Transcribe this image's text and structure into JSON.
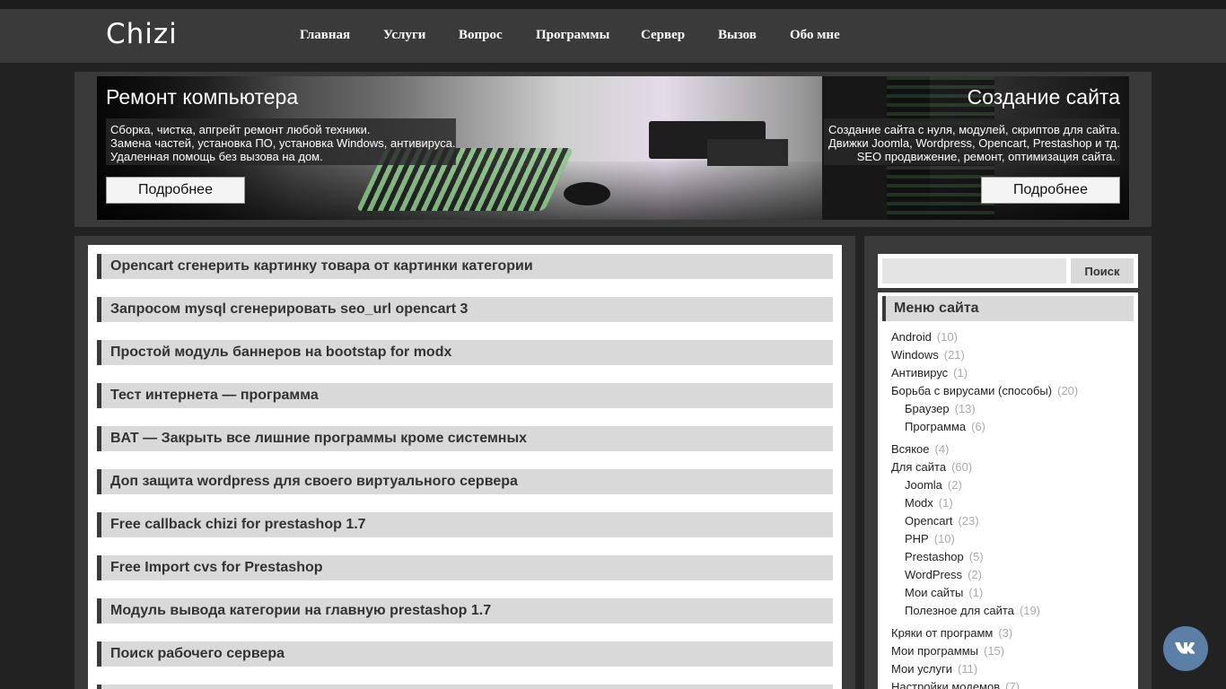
{
  "header": {
    "logo": "Chizi",
    "nav": [
      "Главная",
      "Услуги",
      "Вопрос",
      "Программы",
      "Сервер",
      "Вызов",
      "Обо мне"
    ]
  },
  "banner": {
    "left": {
      "title": "Ремонт компьютера",
      "lines": [
        "Сборка, чистка, апгрейт ремонт любой техники.",
        "Замена частей, установка ПО, установка Windows, антивируса.",
        "Удаленная помощь без вызова на дом."
      ],
      "button": "Подробнее"
    },
    "right": {
      "title": "Создание сайта",
      "lines": [
        "Создание сайта с нуля, модулей, скриптов для сайта.",
        "Движки Joomla, Wordpress, Opencart, Prestashop и тд.",
        "SEO продвижение, ремонт, оптимизация сайта."
      ],
      "button": "Подробнее"
    }
  },
  "posts": [
    "Opencart сгенерить картинку товара от картинки категории",
    "Запросом mysql сгенерировать seo_url opencart 3",
    "Простой модуль баннеров на bootstap for modx",
    "Тест интернета — программа",
    "BAT — Закрыть все лишние программы кроме системных",
    "Доп защита wordpress для своего виртуального сервера",
    "Free callback chizi for prestashop 1.7",
    "Free Import cvs for Prestashop",
    "Модуль вывода категории на главную prestashop 1.7",
    "Поиск рабочего сервера"
  ],
  "sidebar": {
    "search": {
      "placeholder": "",
      "button": "Поиск"
    },
    "menu_title": "Меню сайта",
    "categories": [
      {
        "name": "Android",
        "count": "(10)",
        "level": 0
      },
      {
        "name": "Windows",
        "count": "(21)",
        "level": 0
      },
      {
        "name": "Антивирус",
        "count": "(1)",
        "level": 0
      },
      {
        "name": "Борьба с вирусами (способы)",
        "count": "(20)",
        "level": 0
      },
      {
        "name": "Браузер",
        "count": "(13)",
        "level": 1
      },
      {
        "name": "Программа",
        "count": "(6)",
        "level": 1
      },
      {
        "name": "Всякое",
        "count": "(4)",
        "level": 0
      },
      {
        "name": "Для сайта",
        "count": "(60)",
        "level": 0
      },
      {
        "name": "Joomla",
        "count": "(2)",
        "level": 1
      },
      {
        "name": "Modx",
        "count": "(1)",
        "level": 1
      },
      {
        "name": "Opencart",
        "count": "(23)",
        "level": 1
      },
      {
        "name": "PHP",
        "count": "(10)",
        "level": 1
      },
      {
        "name": "Prestashop",
        "count": "(5)",
        "level": 1
      },
      {
        "name": "WordPress",
        "count": "(2)",
        "level": 1
      },
      {
        "name": "Мои сайты",
        "count": "(1)",
        "level": 1
      },
      {
        "name": "Полезное для сайта",
        "count": "(19)",
        "level": 1
      },
      {
        "name": "Кряки от программ",
        "count": "(3)",
        "level": 0
      },
      {
        "name": "Мои программы",
        "count": "(15)",
        "level": 0
      },
      {
        "name": "Мои услуги",
        "count": "(11)",
        "level": 0
      },
      {
        "name": "Настройки модемов",
        "count": "(7)",
        "level": 0
      }
    ]
  },
  "social": {
    "icon": "vk-icon",
    "color": "#5b7fa6"
  },
  "colors": {
    "background": "#222222",
    "panel": "#3a3a3a",
    "title_bar": "#d9d9d9"
  }
}
